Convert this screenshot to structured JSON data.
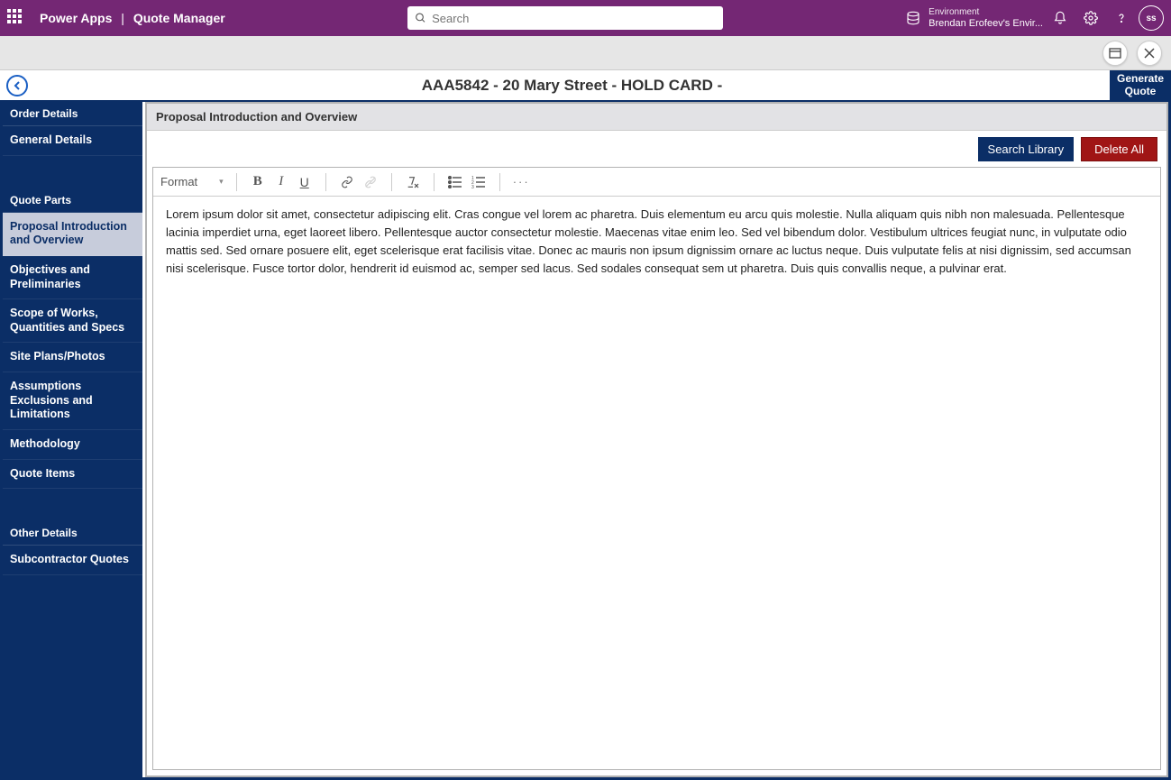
{
  "topbar": {
    "brand_product": "Power Apps",
    "brand_separator": "|",
    "brand_app": "Quote Manager",
    "search_placeholder": "Search",
    "env_label": "Environment",
    "env_value": "Brendan Erofeev's Envir...",
    "avatar_initials": "ss"
  },
  "titlebar": {
    "title": "AAA5842 - 20 Mary Street - HOLD CARD -",
    "generate_quote": "Generate Quote"
  },
  "sidebar": {
    "sections": [
      {
        "header": "Order Details",
        "items": [
          {
            "label": "General Details",
            "selected": false
          }
        ]
      },
      {
        "header": "Quote Parts",
        "items": [
          {
            "label": "Proposal Introduction and Overview",
            "selected": true
          },
          {
            "label": "Objectives and Preliminaries",
            "selected": false
          },
          {
            "label": "Scope of Works, Quantities and Specs",
            "selected": false
          },
          {
            "label": "Site Plans/Photos",
            "selected": false
          },
          {
            "label": "Assumptions Exclusions and Limitations",
            "selected": false
          },
          {
            "label": "Methodology",
            "selected": false
          },
          {
            "label": "Quote Items",
            "selected": false
          }
        ]
      },
      {
        "header": "Other Details",
        "items": [
          {
            "label": "Subcontractor Quotes",
            "selected": false
          }
        ]
      }
    ]
  },
  "content": {
    "section_title": "Proposal Introduction and Overview",
    "search_library": "Search Library",
    "delete_all": "Delete All"
  },
  "editor_toolbar": {
    "format_label": "Format"
  },
  "editor": {
    "body_text": "Lorem ipsum dolor sit amet, consectetur adipiscing elit. Cras congue vel lorem ac pharetra. Duis elementum eu arcu quis molestie. Nulla aliquam quis nibh non malesuada. Pellentesque lacinia imperdiet urna, eget laoreet libero. Pellentesque auctor consectetur molestie. Maecenas vitae enim leo. Sed vel bibendum dolor. Vestibulum ultrices feugiat nunc, in vulputate odio mattis sed. Sed ornare posuere elit, eget scelerisque erat facilisis vitae. Donec ac mauris non ipsum dignissim ornare ac luctus neque. Duis vulputate felis at nisi dignissim, sed accumsan nisi scelerisque. Fusce tortor dolor, hendrerit id euismod ac, semper sed lacus. Sed sodales consequat sem ut pharetra. Duis quis convallis neque, a pulvinar erat."
  }
}
